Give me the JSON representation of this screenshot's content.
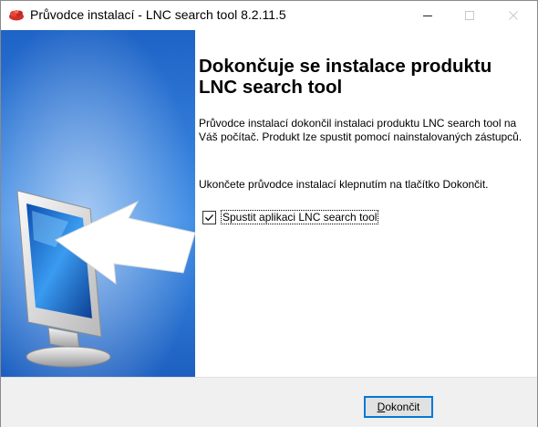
{
  "window": {
    "title": "Průvodce instalací - LNC search tool 8.2.11.5",
    "controls": {
      "minimize": "—",
      "maximize": "☐",
      "close": "✕"
    },
    "icon": "app-logo-icon"
  },
  "banner": {
    "illustration": "monitor-with-arrow-illustration"
  },
  "content": {
    "heading": "Dokončuje se instalace produktu LNC search tool",
    "paragraph1": "Průvodce instalací dokončil instalaci produktu LNC search tool na Váš počítač. Produkt lze spustit pomocí nainstalovaných zástupců.",
    "paragraph2": "Ukončete průvodce instalací klepnutím na tlačítko Dokončit.",
    "launch_checkbox": {
      "label": "Spustit aplikaci LNC search tool",
      "checked": true
    }
  },
  "footer": {
    "finish_button": {
      "accelerator": "D",
      "rest": "okončit"
    }
  },
  "colors": {
    "accent": "#0078d7",
    "footer_bg": "#f0f0f0",
    "banner_blue": "#1f6fd1"
  }
}
